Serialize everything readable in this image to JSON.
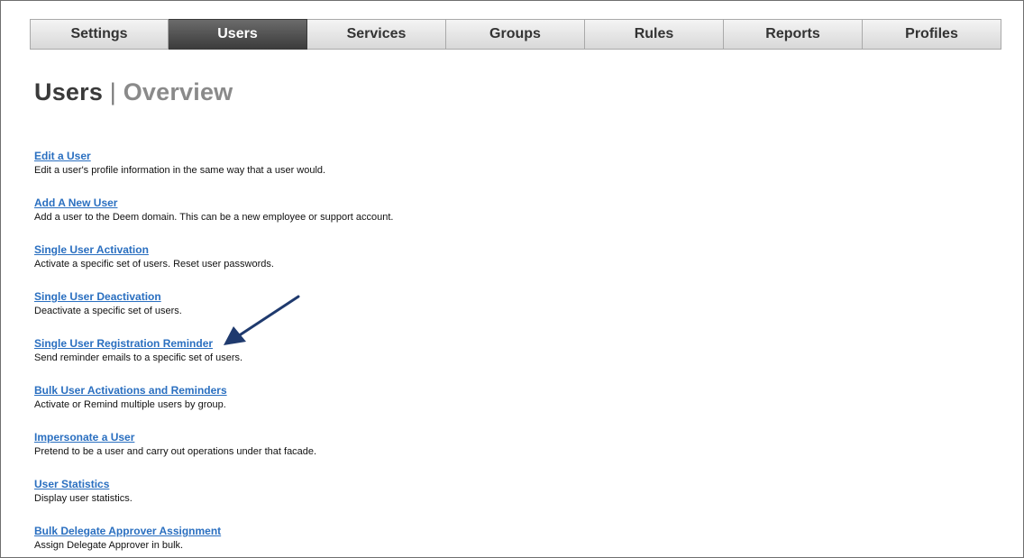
{
  "nav": {
    "tabs": [
      {
        "label": "Settings"
      },
      {
        "label": "Users"
      },
      {
        "label": "Services"
      },
      {
        "label": "Groups"
      },
      {
        "label": "Rules"
      },
      {
        "label": "Reports"
      },
      {
        "label": "Profiles"
      }
    ],
    "active": "Users"
  },
  "page": {
    "title": "Users",
    "separator": "|",
    "subtitle": "Overview"
  },
  "menu": {
    "items": [
      {
        "label": "Edit a User",
        "description": "Edit a user's profile information in the same way that a user would."
      },
      {
        "label": "Add A New User",
        "description": "Add a user to the Deem domain. This can be a new employee or support account."
      },
      {
        "label": "Single User Activation",
        "description": "Activate a specific set of users. Reset user passwords."
      },
      {
        "label": "Single User Deactivation",
        "description": "Deactivate a specific set of users."
      },
      {
        "label": "Single User Registration Reminder",
        "description": "Send reminder emails to a specific set of users."
      },
      {
        "label": "Bulk User Activations and Reminders",
        "description": "Activate or Remind multiple users by group."
      },
      {
        "label": "Impersonate a User",
        "description": "Pretend to be a user and carry out operations under that facade."
      },
      {
        "label": "User Statistics",
        "description": "Display user statistics."
      },
      {
        "label": "Bulk Delegate Approver Assignment",
        "description": "Assign Delegate Approver in bulk."
      }
    ]
  },
  "colors": {
    "link": "#2a6fc0",
    "arrow": "#1f3a6e",
    "active_tab": "#4a4a4a"
  },
  "annotation": {
    "icon": "arrow-icon",
    "points_to": "Single User Registration Reminder"
  }
}
